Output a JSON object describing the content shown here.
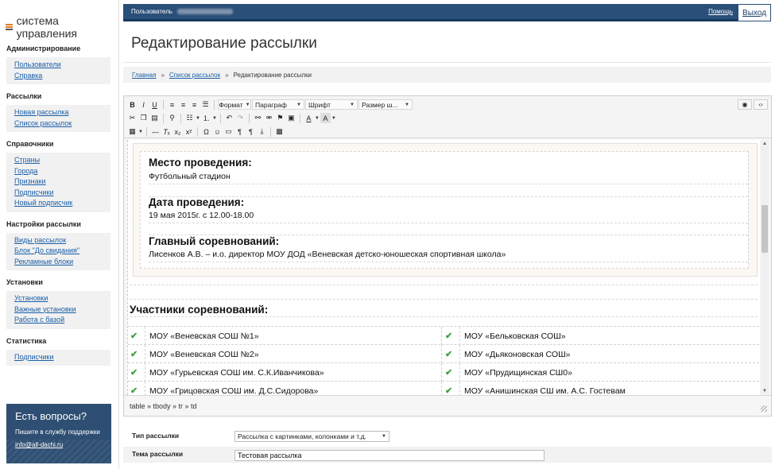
{
  "app": {
    "logo_text": "система управления"
  },
  "sidebar": {
    "sections": [
      {
        "title": "Администрирование",
        "items": [
          "Пользователи",
          "Справка"
        ]
      },
      {
        "title": "Рассылки",
        "items": [
          "Новая рассылка",
          "Список рассылок"
        ]
      },
      {
        "title": "Справочники",
        "items": [
          "Страны",
          "Города",
          "Признаки",
          "Подписчики",
          "Новый подписчик"
        ]
      },
      {
        "title": "Настройки рассылки",
        "items": [
          "Виды рассылок",
          "Блок \"До свидания\"",
          "Рекламные блоки"
        ]
      },
      {
        "title": "Установки",
        "items": [
          "Установки",
          "Важные установки",
          "Работа с базой"
        ]
      },
      {
        "title": "Статистика",
        "items": [
          "Подписчики"
        ]
      }
    ],
    "help": {
      "heading": "Есть вопросы?",
      "text": "Пишите в службу поддержки",
      "email": "info@all-dachi.ru"
    }
  },
  "topbar": {
    "user_label": "Пользователь",
    "help_link": "Помощь",
    "exit_label": "Выход"
  },
  "page": {
    "title": "Редактирование рассылки",
    "breadcrumb": [
      "Главная",
      "Список рассылок",
      "Редактирование рассылки"
    ]
  },
  "editor": {
    "toolbar": {
      "format_dd": "Формат",
      "paragraph_dd": "Параграф",
      "font_dd": "Шрифт",
      "size_dd": "Размер ш..."
    },
    "content": {
      "fields": [
        {
          "label": "Место проведения:",
          "value": "Футбольный стадион"
        },
        {
          "label": "Дата проведения:",
          "value": "19 мая 2015г. с 12.00-18.00"
        },
        {
          "label": "Главный соревнований:",
          "value": "Лисенков А.В. – и.о. директор МОУ ДОД «Веневская детско-юношеская спортивная школа»"
        }
      ],
      "participants_title": "Участники соревнований:",
      "participants": [
        [
          "МОУ «Веневская СОШ №1»",
          "МОУ «Бельковская СОШ»"
        ],
        [
          "МОУ «Веневская СОШ №2»",
          "МОУ «Дьяконовская СОШ»"
        ],
        [
          "МОУ «Гурьевская СОШ им. С.К.Иванчикова»",
          "МОУ «Прудищинская СШ0»"
        ],
        [
          "МОУ «Грицовская СОШ им. Д.С.Сидорова»",
          "МОУ «Анишинская СШ им. А.С. Гостевам"
        ]
      ]
    },
    "statusbar_path": "table » tbody » tr » td"
  },
  "form": {
    "type_label": "Тип рассылки",
    "type_value": "Рассылка с картинками, колонками и т.д.",
    "subject_label": "Тема рассылки",
    "subject_value": "Тестовая рассылка"
  },
  "colors": {
    "topbar": "#2a4f78",
    "help_box": "#2e4f73",
    "link": "#1a5fa8",
    "check": "#3ea03e"
  }
}
